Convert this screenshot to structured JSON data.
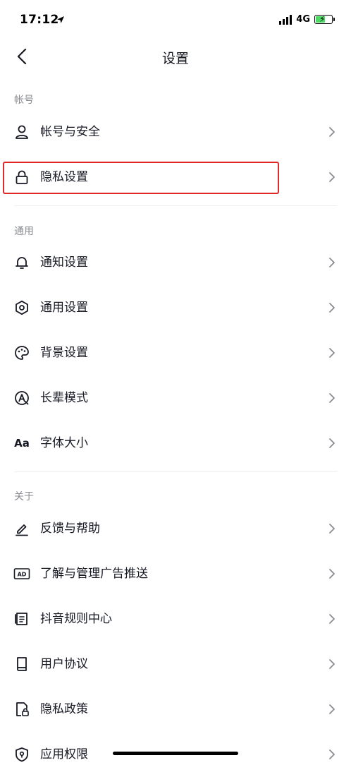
{
  "status_bar": {
    "time": "17:12",
    "network": "4G"
  },
  "nav": {
    "title": "设置"
  },
  "sections": {
    "account": "帐号",
    "general": "通用",
    "about": "关于"
  },
  "items": {
    "account_security": "帐号与安全",
    "privacy_settings": "隐私设置",
    "notification_settings": "通知设置",
    "general_settings": "通用设置",
    "background_settings": "背景设置",
    "elder_mode": "长辈模式",
    "font_size_icon_text": "Aa",
    "font_size": "字体大小",
    "feedback_help": "反馈与帮助",
    "ad_icon_text": "AD",
    "ad_management": "了解与管理广告推送",
    "community_rules": "抖音规则中心",
    "user_agreement": "用户协议",
    "privacy_policy": "隐私政策",
    "app_permissions": "应用权限"
  },
  "colors": {
    "highlight": "#e0282b",
    "text": "#161823",
    "secondary": "#8a8b91"
  }
}
